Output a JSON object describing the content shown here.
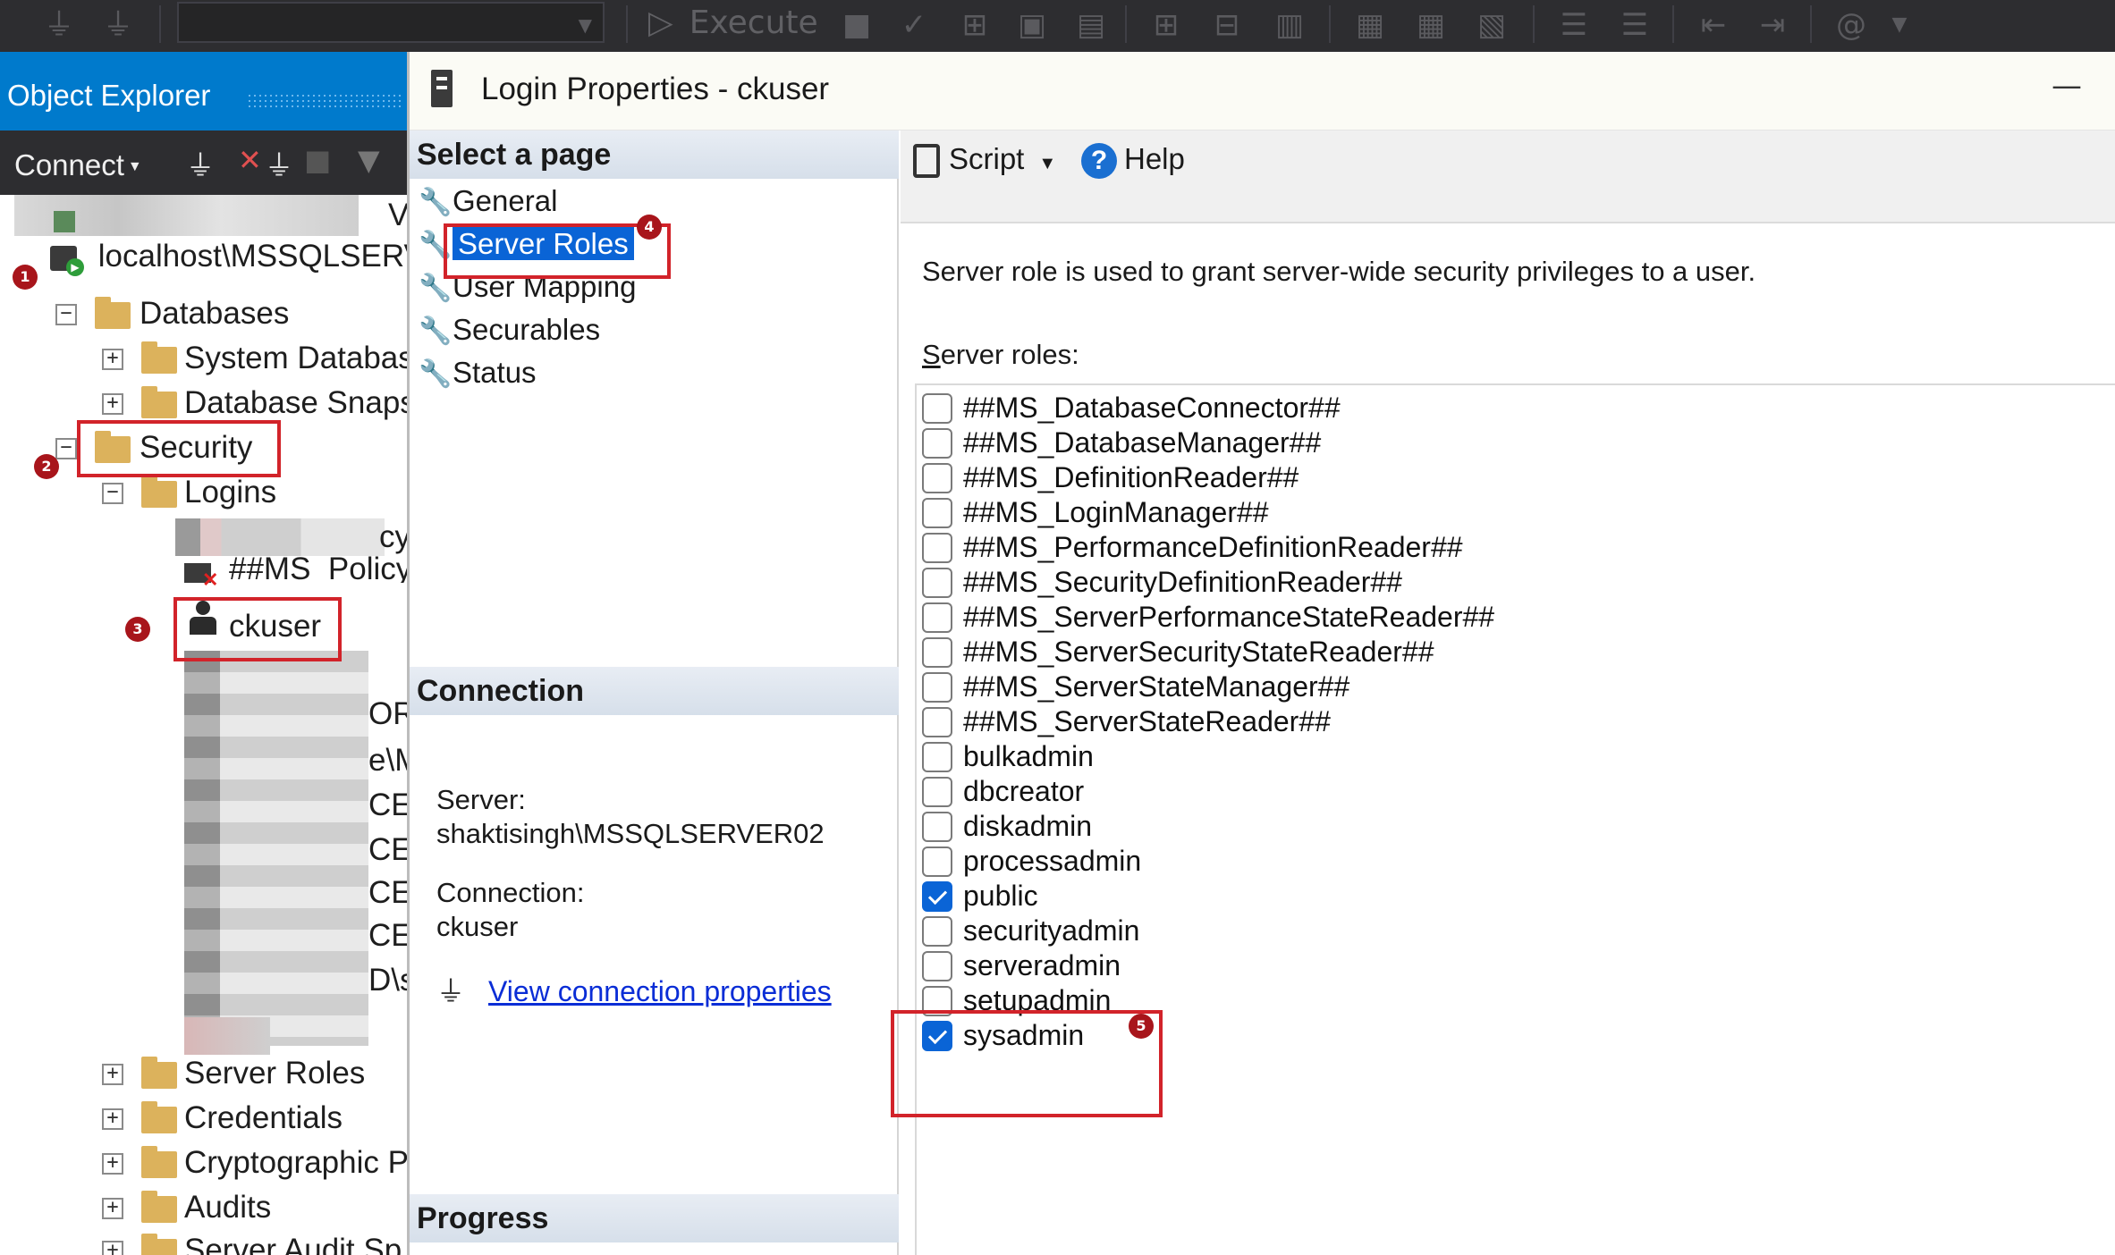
{
  "toolbar": {
    "execute_label": "Execute"
  },
  "object_explorer": {
    "title": "Object Explorer",
    "connect_label": "Connect",
    "tree": {
      "server_partial": "localhost\\MSSQLSERV",
      "databases": "Databases",
      "system_databases": "System Databas",
      "database_snapshots": "Database Snaps",
      "security": "Security",
      "logins": "Logins",
      "login_partial_1": "cy",
      "login_partial_2": "##MS_Policy",
      "ckuser": "ckuser",
      "obscured_suffixes": [
        "OR",
        "e\\M",
        "CE\\",
        "CE\\",
        "CE\\",
        "CE\\",
        "D\\s"
      ],
      "server_roles": "Server Roles",
      "credentials": "Credentials",
      "cryptographic": "Cryptographic P",
      "audits": "Audits",
      "server_audit": "Server Audit Sp"
    },
    "top_partial": "V"
  },
  "dialog": {
    "title": "Login Properties - ckuser",
    "select_page_header": "Select a page",
    "pages": [
      "General",
      "Server Roles",
      "User Mapping",
      "Securables",
      "Status"
    ],
    "selected_page": "Server Roles",
    "connection_header": "Connection",
    "server_label": "Server:",
    "server_value": "shaktisingh\\MSSQLSERVER02",
    "connection_label": "Connection:",
    "connection_value": "ckuser",
    "view_connection_link": "View connection properties",
    "progress_header": "Progress",
    "script_label": "Script",
    "help_label": "Help",
    "description": "Server role is used to grant server-wide security privileges to a user.",
    "roles_label_prefix": "S",
    "roles_label_rest": "erver roles:",
    "roles": [
      {
        "name": "##MS_DatabaseConnector##",
        "checked": false
      },
      {
        "name": "##MS_DatabaseManager##",
        "checked": false
      },
      {
        "name": "##MS_DefinitionReader##",
        "checked": false
      },
      {
        "name": "##MS_LoginManager##",
        "checked": false
      },
      {
        "name": "##MS_PerformanceDefinitionReader##",
        "checked": false
      },
      {
        "name": "##MS_SecurityDefinitionReader##",
        "checked": false
      },
      {
        "name": "##MS_ServerPerformanceStateReader##",
        "checked": false
      },
      {
        "name": "##MS_ServerSecurityStateReader##",
        "checked": false
      },
      {
        "name": "##MS_ServerStateManager##",
        "checked": false
      },
      {
        "name": "##MS_ServerStateReader##",
        "checked": false
      },
      {
        "name": "bulkadmin",
        "checked": false
      },
      {
        "name": "dbcreator",
        "checked": false
      },
      {
        "name": "diskadmin",
        "checked": false
      },
      {
        "name": "processadmin",
        "checked": false
      },
      {
        "name": "public",
        "checked": true
      },
      {
        "name": "securityadmin",
        "checked": false
      },
      {
        "name": "serveradmin",
        "checked": false
      },
      {
        "name": "setupadmin",
        "checked": false
      },
      {
        "name": "sysadmin",
        "checked": true
      }
    ]
  },
  "annotations": [
    "1",
    "2",
    "3",
    "4",
    "5"
  ],
  "colors": {
    "accent": "#007acc",
    "selection": "#0a64d6",
    "annotation": "#d2232a",
    "link": "#0a2dd6"
  }
}
